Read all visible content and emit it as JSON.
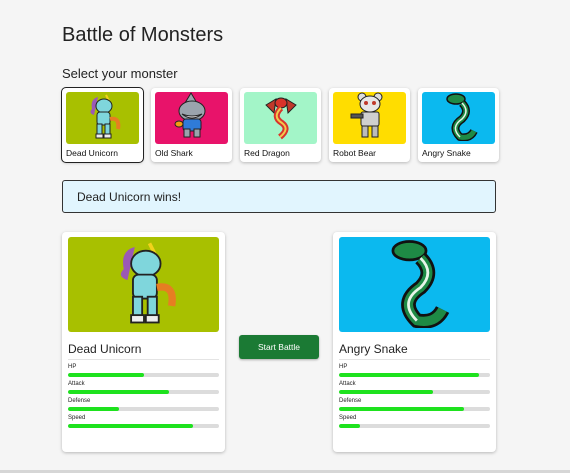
{
  "header": {
    "title": "Battle of Monsters"
  },
  "selector": {
    "label": "Select your monster",
    "selected_index": 0,
    "monsters": [
      {
        "name": "Dead Unicorn",
        "icon": "unicorn-icon",
        "bg": "#a8c000"
      },
      {
        "name": "Old Shark",
        "icon": "shark-icon",
        "bg": "#e8136a"
      },
      {
        "name": "Red Dragon",
        "icon": "dragon-icon",
        "bg": "#a3f5c8"
      },
      {
        "name": "Robot Bear",
        "icon": "robot-bear-icon",
        "bg": "#ffdd00"
      },
      {
        "name": "Angry Snake",
        "icon": "snake-icon",
        "bg": "#0bb9ef"
      }
    ]
  },
  "banner": {
    "text": "Dead Unicorn wins!"
  },
  "battle": {
    "start_label": "Start Battle"
  },
  "player": {
    "name": "Dead Unicorn",
    "icon": "unicorn-icon",
    "bg": "#a8c000",
    "stats": [
      {
        "label": "HP",
        "value": 0.5
      },
      {
        "label": "Attack",
        "value": 0.67
      },
      {
        "label": "Defense",
        "value": 0.34
      },
      {
        "label": "Speed",
        "value": 0.83
      }
    ]
  },
  "opponent": {
    "name": "Angry Snake",
    "icon": "snake-icon",
    "bg": "#0bb9ef",
    "stats": [
      {
        "label": "HP",
        "value": 0.93
      },
      {
        "label": "Attack",
        "value": 0.62
      },
      {
        "label": "Defense",
        "value": 0.83
      },
      {
        "label": "Speed",
        "value": 0.14
      }
    ]
  },
  "colors": {
    "accent": "#1b7a34",
    "stat_fill": "#1ee21e",
    "banner_bg": "#e1f5fe"
  }
}
